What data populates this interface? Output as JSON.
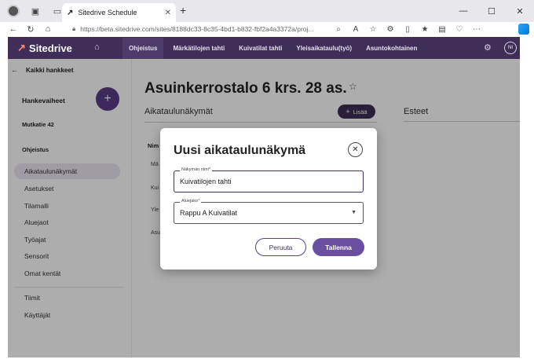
{
  "browser": {
    "tab_title": "Sitedrive Schedule",
    "url": "https://beta.sitedrive.com/sites/8188dc33-8c35-4bd1-b832-fbf2a4a3372a/proj..."
  },
  "app": {
    "logo": "Sitedrive",
    "nav": [
      "Ohjeistus",
      "Märkätilojen tahti",
      "Kuivatilat tahti",
      "Yleisaikataulu(työ)",
      "Asuntokohtainen"
    ],
    "user_initials": "NI"
  },
  "sidebar": {
    "back": "Kaikki hankkeet",
    "phases_title": "Hankevaiheet",
    "site": "Mutkatie 42",
    "section": "Ohjeistus",
    "items": [
      "Aikataulunäkymät",
      "Asetukset",
      "Tilamalli",
      "Aluejaot",
      "Työajat",
      "Sensorit",
      "Omat kentät"
    ],
    "bottom_items": [
      "Tiimit",
      "Käyttäjät"
    ]
  },
  "main": {
    "title": "Asuinkerrostalo 6 krs. 28 as.",
    "section_title": "Aikataulunäkymät",
    "add_label": "Lisää",
    "side_section": "Esteet",
    "table_header": "Nim",
    "fragments": [
      "Mä",
      "Kui",
      "Yle",
      "Asu"
    ]
  },
  "dialog": {
    "title": "Uusi aikataulunäkymä",
    "name_label": "Näkymän nimi*",
    "name_value": "Kuivatilojen tahti",
    "area_label": "Aluejako*",
    "area_value": "Rappu A Kuivatilat",
    "cancel": "Peruuta",
    "save": "Tallenna"
  }
}
